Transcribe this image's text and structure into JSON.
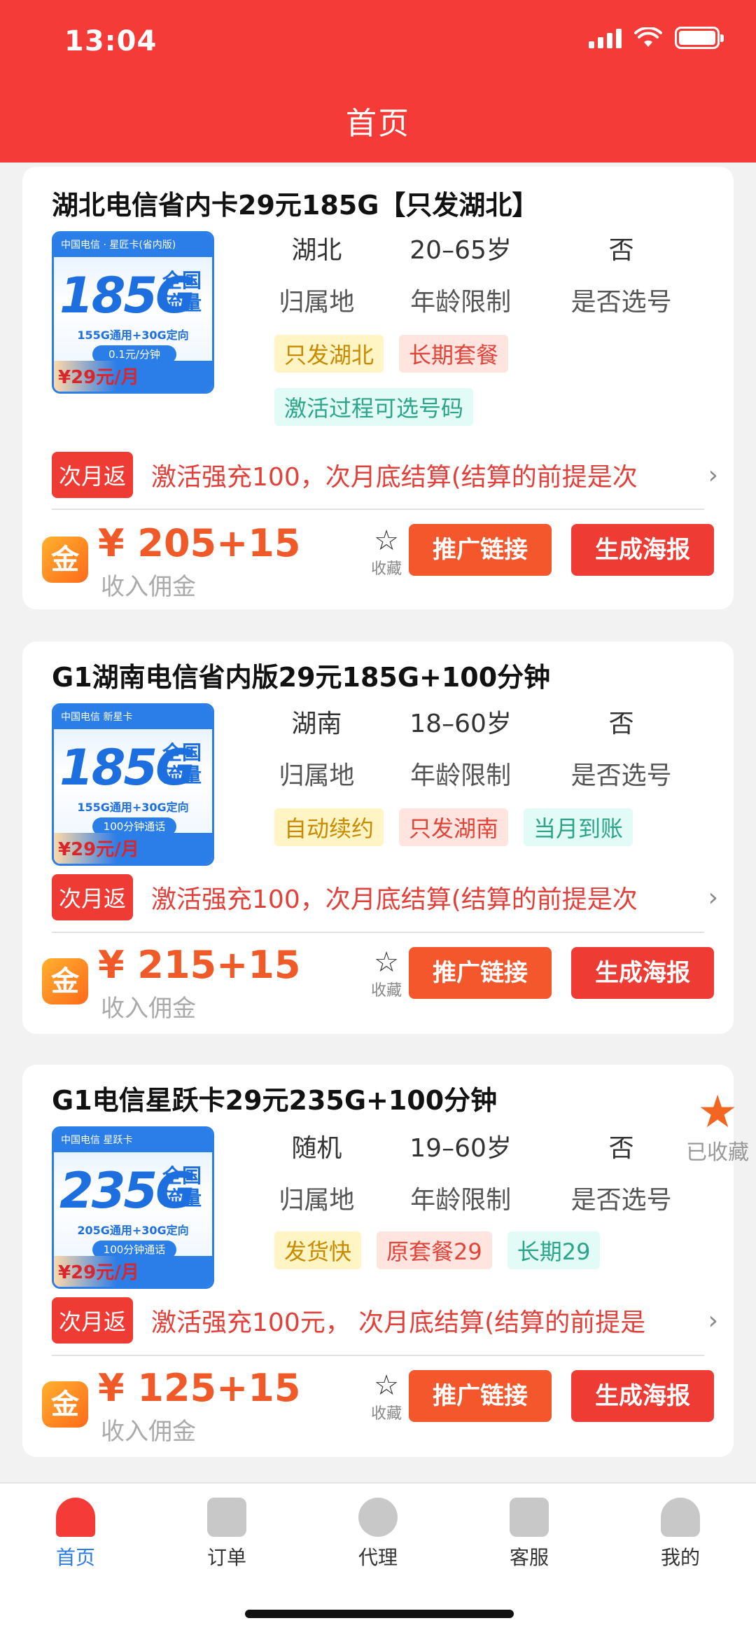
{
  "status_bar": {
    "time": "13:04"
  },
  "header": {
    "title": "首页"
  },
  "cards": [
    {
      "title": "湖北电信省内卡29元185G【只发湖北】",
      "thumb": {
        "brand": "中国电信 · 星匠卡(省内版)",
        "data": "185G",
        "flow": "全国流量",
        "line": "155G通用+30G定向",
        "pill": "0.1元/分钟",
        "price": "¥29元/月"
      },
      "attrs": {
        "location": "湖北",
        "age": "20–65岁",
        "select": "否",
        "location_label": "归属地",
        "age_label": "年龄限制",
        "select_label": "是否选号"
      },
      "tags": [
        {
          "text": "只发湖北",
          "color": "yellow"
        },
        {
          "text": "长期套餐",
          "color": "pink"
        },
        {
          "text": "激活过程可选号码",
          "color": "mint"
        }
      ],
      "rebate_badge": "次月返",
      "rebate_text": "激活强充100，次月底结算(结算的前提是次",
      "price": "¥ 205+15",
      "income_label": "收入佣金",
      "fav_label": "收藏",
      "link_button": "推广链接",
      "poster_button": "生成海报"
    },
    {
      "title": "G1湖南电信省内版29元185G+100分钟",
      "thumb": {
        "brand": "中国电信 新星卡",
        "data": "185G",
        "flow": "全国流量",
        "line": "155G通用+30G定向",
        "pill": "100分钟通话",
        "price": "¥29元/月"
      },
      "attrs": {
        "location": "湖南",
        "age": "18–60岁",
        "select": "否",
        "location_label": "归属地",
        "age_label": "年龄限制",
        "select_label": "是否选号"
      },
      "tags": [
        {
          "text": "自动续约",
          "color": "yellow"
        },
        {
          "text": "只发湖南",
          "color": "pink"
        },
        {
          "text": "当月到账",
          "color": "mint"
        }
      ],
      "rebate_badge": "次月返",
      "rebate_text": "激活强充100，次月底结算(结算的前提是次",
      "price": "¥ 215+15",
      "income_label": "收入佣金",
      "fav_label": "收藏",
      "link_button": "推广链接",
      "poster_button": "生成海报"
    },
    {
      "title": "G1电信星跃卡29元235G+100分钟",
      "thumb": {
        "brand": "中国电信 星跃卡",
        "data": "235G",
        "flow": "全国流量",
        "line": "205G通用+30G定向",
        "pill": "100分钟通话",
        "price": "¥29元/月"
      },
      "attrs": {
        "location": "随机",
        "age": "19–60岁",
        "select": "否",
        "location_label": "归属地",
        "age_label": "年龄限制",
        "select_label": "是否选号"
      },
      "tags": [
        {
          "text": "发货快",
          "color": "yellow"
        },
        {
          "text": "原套餐29",
          "color": "pink"
        },
        {
          "text": "长期29",
          "color": "mint"
        }
      ],
      "rebate_badge": "次月返",
      "rebate_text": "激活强充100元，  次月底结算(结算的前提是",
      "price": "¥ 125+15",
      "income_label": "收入佣金",
      "fav_label": "收藏",
      "link_button": "推广链接",
      "poster_button": "生成海报"
    }
  ],
  "collected": {
    "label": "已收藏"
  },
  "tabbar": {
    "items": [
      {
        "label": "首页",
        "icon": "home-icon",
        "active": true
      },
      {
        "label": "订单",
        "icon": "order-icon",
        "active": false
      },
      {
        "label": "代理",
        "icon": "agent-icon",
        "active": false
      },
      {
        "label": "客服",
        "icon": "service-icon",
        "active": false
      },
      {
        "label": "我的",
        "icon": "profile-icon",
        "active": false
      }
    ]
  },
  "colors": {
    "brand_red": "#f43b37",
    "price_orange": "#f05a28",
    "tab_active": "#2b7de8"
  }
}
